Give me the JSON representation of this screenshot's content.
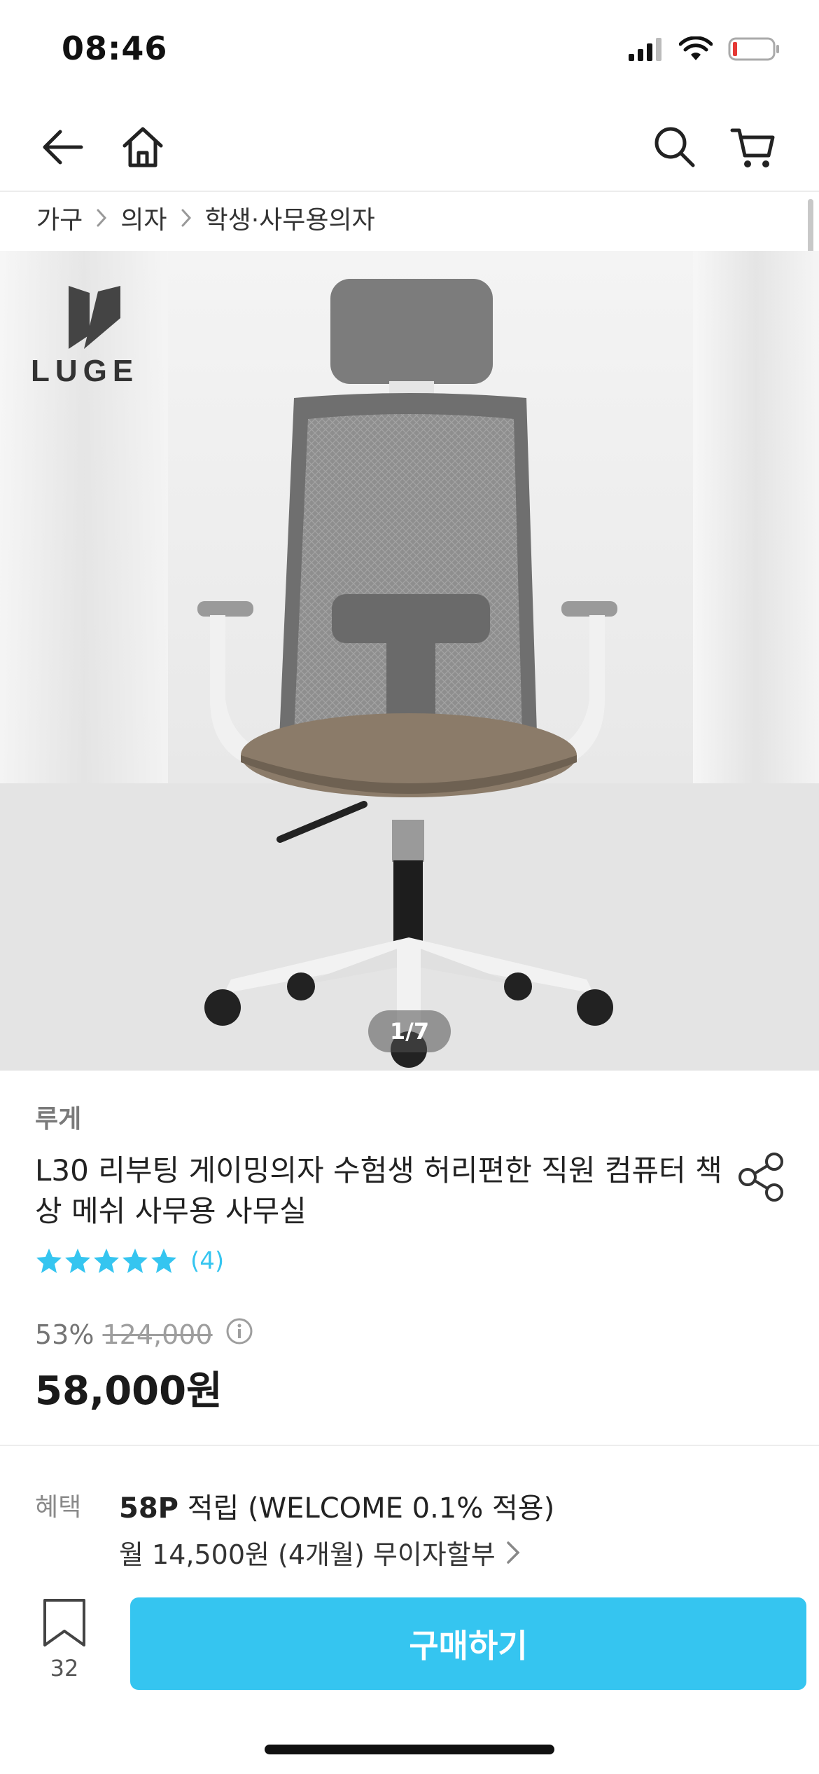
{
  "status_bar": {
    "time": "08:46"
  },
  "breadcrumb": [
    "가구",
    "의자",
    "학생·사무용의자"
  ],
  "hero": {
    "logo_text": "LUGE",
    "page_indicator": "1/7"
  },
  "product": {
    "brand": "루게",
    "title": "L30 리부팅 게이밍의자 수험생 허리편한 직원 컴퓨터 책상 메쉬 사무용 사무실",
    "rating_stars": 5,
    "rating_count": "(4)",
    "discount": "53%",
    "original_price": "124,000",
    "price": "58,000원"
  },
  "benefit": {
    "label": "혜택",
    "points_value": "58P",
    "points_text": " 적립 (WELCOME 0.1% 적용)",
    "installment": "월 14,500원 (4개월) 무이자할부"
  },
  "bottom": {
    "bookmark_count": "32",
    "buy_label": "구매하기"
  },
  "colors": {
    "accent": "#35c5f0",
    "battery_low": "#e53935"
  }
}
